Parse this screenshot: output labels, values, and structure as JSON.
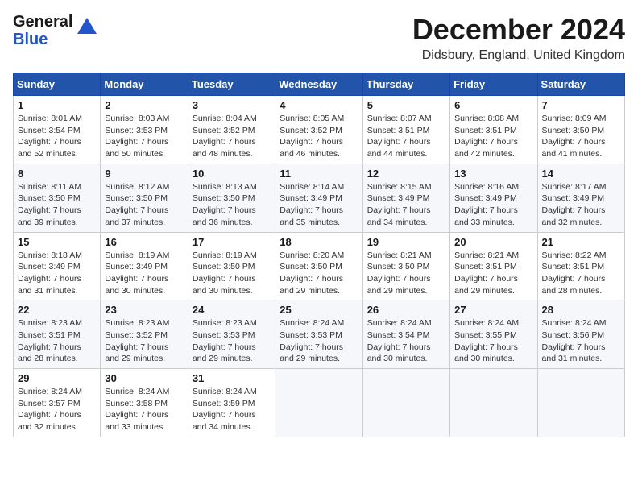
{
  "logo": {
    "general": "General",
    "blue": "Blue"
  },
  "title": "December 2024",
  "location": "Didsbury, England, United Kingdom",
  "days_header": [
    "Sunday",
    "Monday",
    "Tuesday",
    "Wednesday",
    "Thursday",
    "Friday",
    "Saturday"
  ],
  "weeks": [
    [
      {
        "day": "1",
        "sunrise": "Sunrise: 8:01 AM",
        "sunset": "Sunset: 3:54 PM",
        "daylight": "Daylight: 7 hours and 52 minutes."
      },
      {
        "day": "2",
        "sunrise": "Sunrise: 8:03 AM",
        "sunset": "Sunset: 3:53 PM",
        "daylight": "Daylight: 7 hours and 50 minutes."
      },
      {
        "day": "3",
        "sunrise": "Sunrise: 8:04 AM",
        "sunset": "Sunset: 3:52 PM",
        "daylight": "Daylight: 7 hours and 48 minutes."
      },
      {
        "day": "4",
        "sunrise": "Sunrise: 8:05 AM",
        "sunset": "Sunset: 3:52 PM",
        "daylight": "Daylight: 7 hours and 46 minutes."
      },
      {
        "day": "5",
        "sunrise": "Sunrise: 8:07 AM",
        "sunset": "Sunset: 3:51 PM",
        "daylight": "Daylight: 7 hours and 44 minutes."
      },
      {
        "day": "6",
        "sunrise": "Sunrise: 8:08 AM",
        "sunset": "Sunset: 3:51 PM",
        "daylight": "Daylight: 7 hours and 42 minutes."
      },
      {
        "day": "7",
        "sunrise": "Sunrise: 8:09 AM",
        "sunset": "Sunset: 3:50 PM",
        "daylight": "Daylight: 7 hours and 41 minutes."
      }
    ],
    [
      {
        "day": "8",
        "sunrise": "Sunrise: 8:11 AM",
        "sunset": "Sunset: 3:50 PM",
        "daylight": "Daylight: 7 hours and 39 minutes."
      },
      {
        "day": "9",
        "sunrise": "Sunrise: 8:12 AM",
        "sunset": "Sunset: 3:50 PM",
        "daylight": "Daylight: 7 hours and 37 minutes."
      },
      {
        "day": "10",
        "sunrise": "Sunrise: 8:13 AM",
        "sunset": "Sunset: 3:50 PM",
        "daylight": "Daylight: 7 hours and 36 minutes."
      },
      {
        "day": "11",
        "sunrise": "Sunrise: 8:14 AM",
        "sunset": "Sunset: 3:49 PM",
        "daylight": "Daylight: 7 hours and 35 minutes."
      },
      {
        "day": "12",
        "sunrise": "Sunrise: 8:15 AM",
        "sunset": "Sunset: 3:49 PM",
        "daylight": "Daylight: 7 hours and 34 minutes."
      },
      {
        "day": "13",
        "sunrise": "Sunrise: 8:16 AM",
        "sunset": "Sunset: 3:49 PM",
        "daylight": "Daylight: 7 hours and 33 minutes."
      },
      {
        "day": "14",
        "sunrise": "Sunrise: 8:17 AM",
        "sunset": "Sunset: 3:49 PM",
        "daylight": "Daylight: 7 hours and 32 minutes."
      }
    ],
    [
      {
        "day": "15",
        "sunrise": "Sunrise: 8:18 AM",
        "sunset": "Sunset: 3:49 PM",
        "daylight": "Daylight: 7 hours and 31 minutes."
      },
      {
        "day": "16",
        "sunrise": "Sunrise: 8:19 AM",
        "sunset": "Sunset: 3:49 PM",
        "daylight": "Daylight: 7 hours and 30 minutes."
      },
      {
        "day": "17",
        "sunrise": "Sunrise: 8:19 AM",
        "sunset": "Sunset: 3:50 PM",
        "daylight": "Daylight: 7 hours and 30 minutes."
      },
      {
        "day": "18",
        "sunrise": "Sunrise: 8:20 AM",
        "sunset": "Sunset: 3:50 PM",
        "daylight": "Daylight: 7 hours and 29 minutes."
      },
      {
        "day": "19",
        "sunrise": "Sunrise: 8:21 AM",
        "sunset": "Sunset: 3:50 PM",
        "daylight": "Daylight: 7 hours and 29 minutes."
      },
      {
        "day": "20",
        "sunrise": "Sunrise: 8:21 AM",
        "sunset": "Sunset: 3:51 PM",
        "daylight": "Daylight: 7 hours and 29 minutes."
      },
      {
        "day": "21",
        "sunrise": "Sunrise: 8:22 AM",
        "sunset": "Sunset: 3:51 PM",
        "daylight": "Daylight: 7 hours and 28 minutes."
      }
    ],
    [
      {
        "day": "22",
        "sunrise": "Sunrise: 8:23 AM",
        "sunset": "Sunset: 3:51 PM",
        "daylight": "Daylight: 7 hours and 28 minutes."
      },
      {
        "day": "23",
        "sunrise": "Sunrise: 8:23 AM",
        "sunset": "Sunset: 3:52 PM",
        "daylight": "Daylight: 7 hours and 29 minutes."
      },
      {
        "day": "24",
        "sunrise": "Sunrise: 8:23 AM",
        "sunset": "Sunset: 3:53 PM",
        "daylight": "Daylight: 7 hours and 29 minutes."
      },
      {
        "day": "25",
        "sunrise": "Sunrise: 8:24 AM",
        "sunset": "Sunset: 3:53 PM",
        "daylight": "Daylight: 7 hours and 29 minutes."
      },
      {
        "day": "26",
        "sunrise": "Sunrise: 8:24 AM",
        "sunset": "Sunset: 3:54 PM",
        "daylight": "Daylight: 7 hours and 30 minutes."
      },
      {
        "day": "27",
        "sunrise": "Sunrise: 8:24 AM",
        "sunset": "Sunset: 3:55 PM",
        "daylight": "Daylight: 7 hours and 30 minutes."
      },
      {
        "day": "28",
        "sunrise": "Sunrise: 8:24 AM",
        "sunset": "Sunset: 3:56 PM",
        "daylight": "Daylight: 7 hours and 31 minutes."
      }
    ],
    [
      {
        "day": "29",
        "sunrise": "Sunrise: 8:24 AM",
        "sunset": "Sunset: 3:57 PM",
        "daylight": "Daylight: 7 hours and 32 minutes."
      },
      {
        "day": "30",
        "sunrise": "Sunrise: 8:24 AM",
        "sunset": "Sunset: 3:58 PM",
        "daylight": "Daylight: 7 hours and 33 minutes."
      },
      {
        "day": "31",
        "sunrise": "Sunrise: 8:24 AM",
        "sunset": "Sunset: 3:59 PM",
        "daylight": "Daylight: 7 hours and 34 minutes."
      },
      null,
      null,
      null,
      null
    ]
  ]
}
